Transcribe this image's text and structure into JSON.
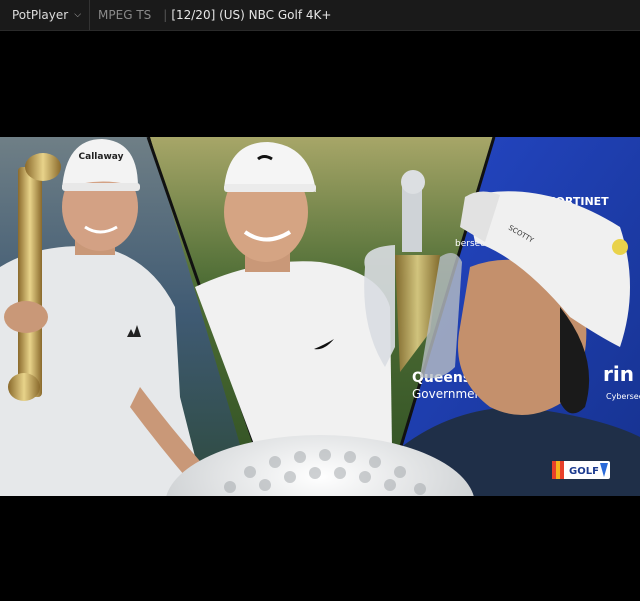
{
  "titlebar": {
    "app_name": "PotPlayer",
    "format": "MPEG TS",
    "separator": "|",
    "file_title": "[12/20] (US) NBC Golf 4K+"
  },
  "video": {
    "frame_left": {
      "cap_brand": "Callaway"
    },
    "frame_right": {
      "banner_brand": "FORTINET",
      "banner_region": "Queensland",
      "banner_government": "Government",
      "banner_partial_left": "bersecu",
      "banner_partial_right": "rin",
      "banner_cyber": "Cybersec",
      "cap_brand": "SCOTTY"
    },
    "network_logo": "GOLF"
  },
  "colors": {
    "titlebar_bg": "#1a1a1a",
    "banner_blue": "#1e3fb0",
    "letterbox": "#000000"
  }
}
